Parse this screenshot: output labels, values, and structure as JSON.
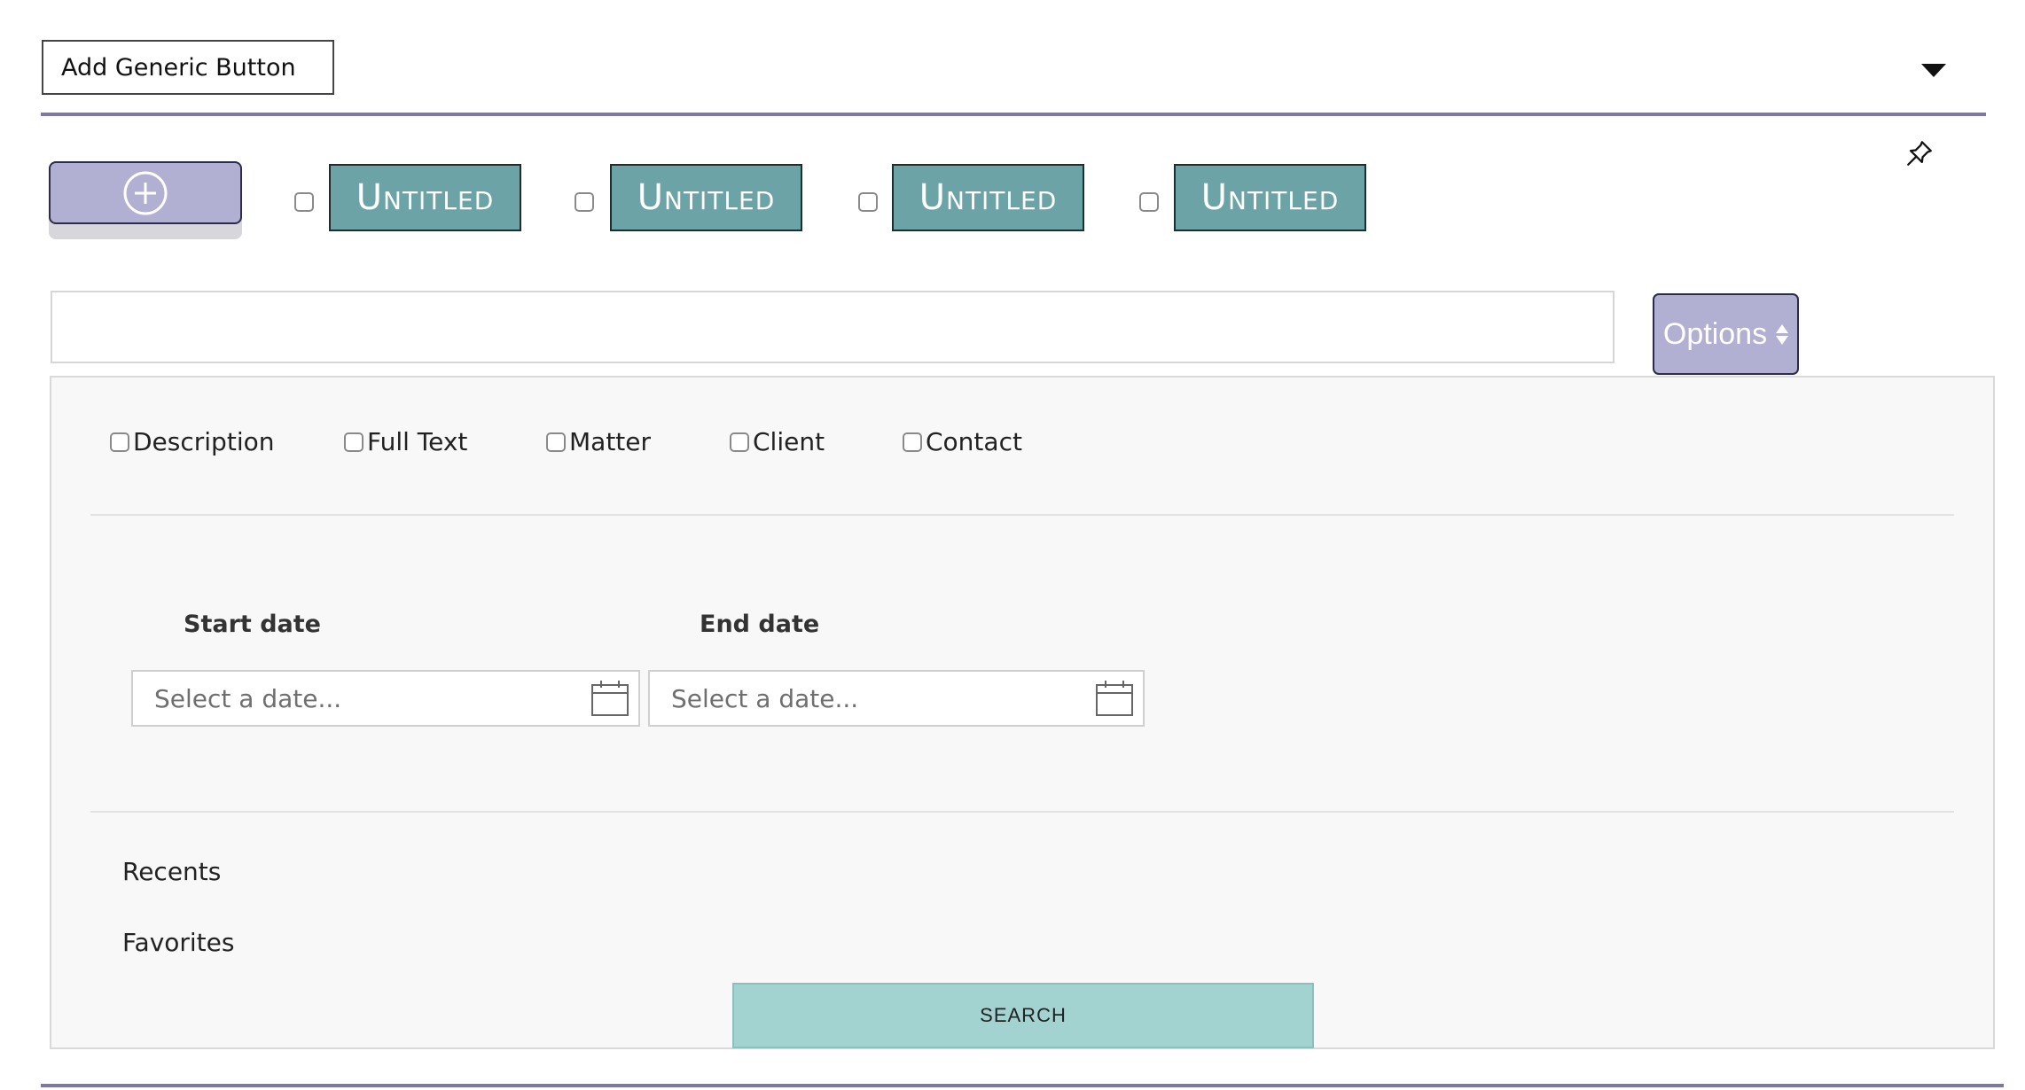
{
  "header": {
    "add_generic_button_label": "Add Generic Button",
    "dropdown_icon": "caret-down-icon",
    "pin_icon": "pin-icon"
  },
  "toolbar": {
    "add_button_icon": "plus-circle-icon",
    "untitled_buttons": [
      {
        "label": "Untitled",
        "checked": false
      },
      {
        "label": "Untitled",
        "checked": false
      },
      {
        "label": "Untitled",
        "checked": false
      },
      {
        "label": "Untitled",
        "checked": false
      }
    ]
  },
  "search": {
    "value": "",
    "options_label": "Options"
  },
  "filters": [
    {
      "label": "Description",
      "checked": false
    },
    {
      "label": "Full Text",
      "checked": false
    },
    {
      "label": "Matter",
      "checked": false
    },
    {
      "label": "Client",
      "checked": false
    },
    {
      "label": "Contact",
      "checked": false
    }
  ],
  "dates": {
    "start_label": "Start date",
    "start_placeholder": "Select a date...",
    "end_label": "End date",
    "end_placeholder": "Select a date..."
  },
  "links": {
    "recents": "Recents",
    "favorites": "Favorites"
  },
  "search_button_label": "SEARCH",
  "colors": {
    "accent_lavender": "#b1afd2",
    "teal_button": "#6ba3a6",
    "search_button": "#a2d3d0",
    "rule": "#7b78a6",
    "panel_bg": "#f8f8f8"
  }
}
